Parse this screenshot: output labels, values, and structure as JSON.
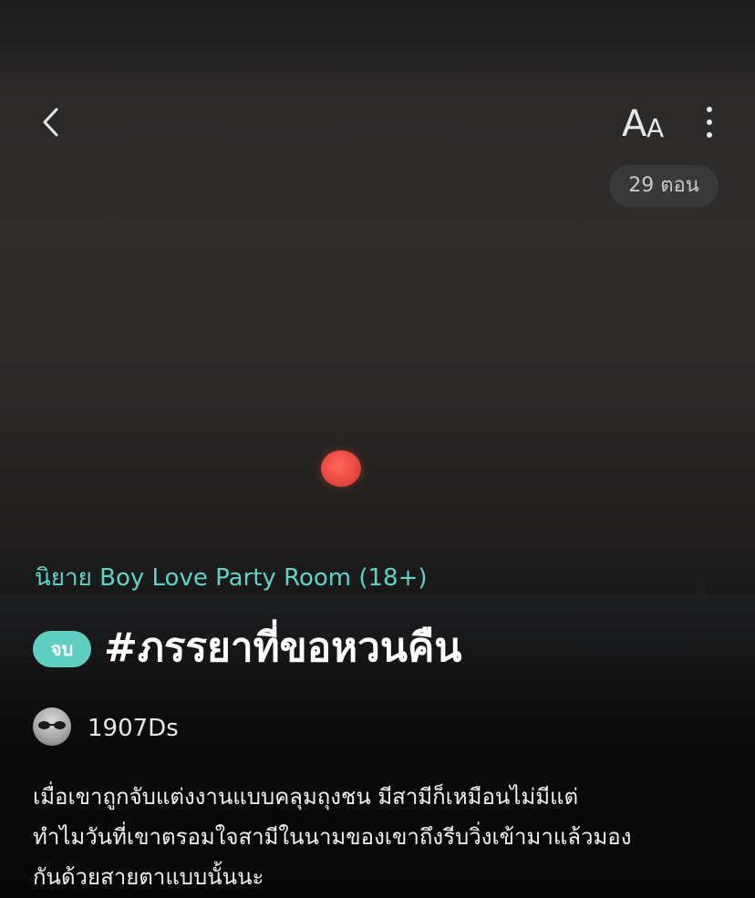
{
  "header": {
    "back_icon": "chevron-left-icon",
    "font_size_icon": "text-size-icon",
    "font_size_label_large": "A",
    "font_size_label_small": "A",
    "more_icon": "more-vertical-icon",
    "episode_count": "29 ตอน"
  },
  "novel": {
    "category": "นิยาย Boy Love Party Room (18+)",
    "status_badge": "จบ",
    "title": "#ภรรยาที่ขอหวนคืน",
    "author": "1907Ds",
    "synopsis_lines": [
      "เมื่อเขาถูกจับแต่งงานแบบคลุมถุงชน มีสามีก็เหมือนไม่มีแต่",
      "ทำไมวันที่เขาตรอมใจสามีในนามของเขาถึงรีบวิ่งเข้ามาแล้วมอง",
      "กันด้วยสายตาแบบนั้นนะ"
    ]
  },
  "colors": {
    "accent": "#5fd3c6",
    "badge": "#5fcfc2",
    "sun": "#e9463d"
  }
}
